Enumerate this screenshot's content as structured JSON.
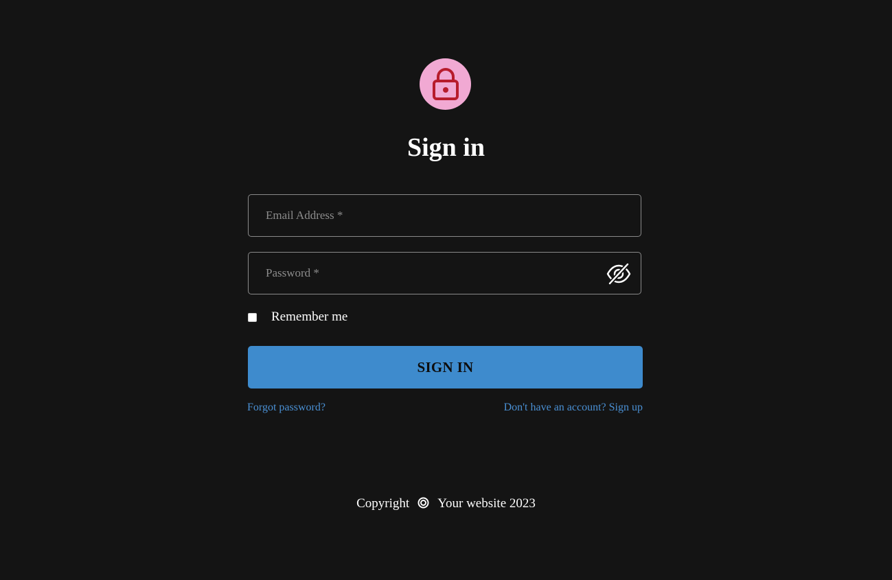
{
  "header": {
    "icon": "lock-icon",
    "icon_bg_color": "#f1a9d3",
    "icon_color": "#b71c2c",
    "title": "Sign in"
  },
  "form": {
    "email": {
      "placeholder": "Email Address *",
      "value": ""
    },
    "password": {
      "placeholder": "Password *",
      "value": "",
      "toggle_icon": "eye-off-icon"
    },
    "remember": {
      "label": "Remember me",
      "checked": false
    },
    "submit_label": "SIGN IN",
    "submit_color": "#3e8bcd"
  },
  "links": {
    "forgot": "Forgot password?",
    "signup": "Don't have an account? Sign up",
    "color": "#4a90d4"
  },
  "footer": {
    "copyright_label": "Copyright",
    "icon": "copyright-icon",
    "site_text": "Your website 2023"
  },
  "colors": {
    "background": "#141414",
    "text": "#ffffff"
  }
}
